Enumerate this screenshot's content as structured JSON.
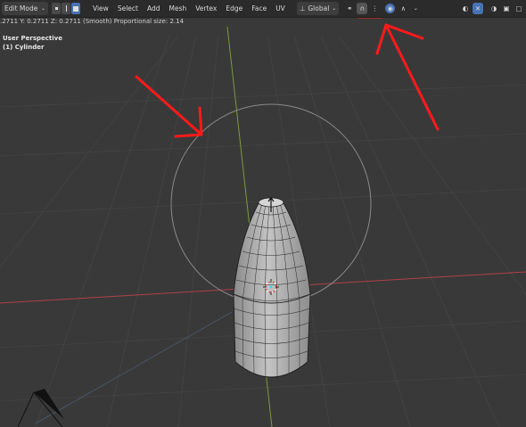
{
  "header": {
    "mode": "Edit Mode",
    "menus": [
      "View",
      "Select",
      "Add",
      "Mesh",
      "Vertex",
      "Edge",
      "Face",
      "UV"
    ],
    "orientation": "Global"
  },
  "status_line": ".2711  Y: 0.2711  Z: 0.2711 (Smooth) Proportional size: 2.14",
  "viewport": {
    "view_name": "User Perspective",
    "object_name": "(1) Cylinder"
  },
  "colors": {
    "background": "#393939",
    "header": "#2b2b2b",
    "annotation": "#ff1a1a",
    "x_axis": "#b0404b",
    "y_axis": "#7a9a3a",
    "accent": "#4772b3"
  },
  "icons": [
    "pivot-icon",
    "snap-icon",
    "proportional-edit-icon",
    "falloff-curve-icon",
    "gizmo-icon",
    "overlay-icon",
    "xray-icon",
    "shading-icon"
  ]
}
